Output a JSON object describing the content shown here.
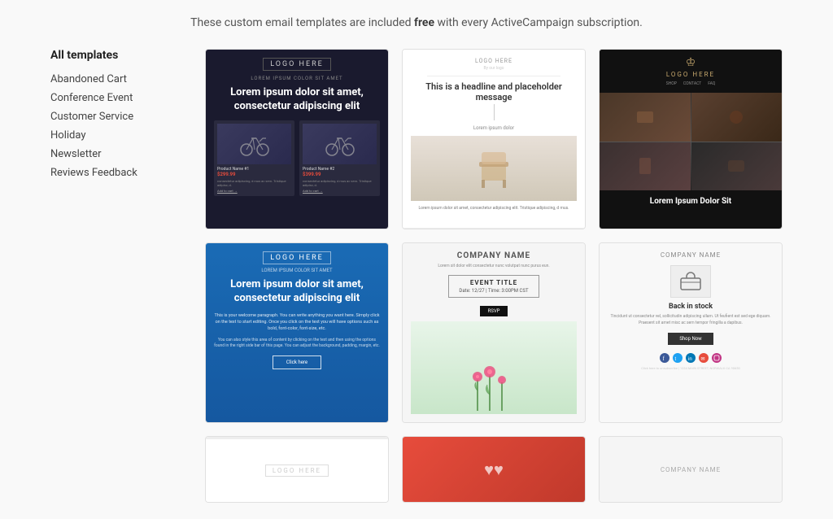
{
  "header": {
    "description_pre": "These custom email templates are included ",
    "description_highlight": "free",
    "description_post": " with every ActiveCampaign subscription."
  },
  "sidebar": {
    "title": "All templates",
    "items": [
      {
        "id": "abandoned-cart",
        "label": "Abandoned Cart"
      },
      {
        "id": "conference-event",
        "label": "Conference Event"
      },
      {
        "id": "customer-service",
        "label": "Customer Service"
      },
      {
        "id": "holiday",
        "label": "Holiday"
      },
      {
        "id": "newsletter",
        "label": "Newsletter"
      },
      {
        "id": "reviews-feedback",
        "label": "Reviews Feedback"
      }
    ]
  },
  "templates": {
    "grid_items": [
      {
        "id": "tpl-1",
        "type": "abandoned-cart-dark",
        "logo": "LOGO HERE",
        "sub": "LOREM IPSUM COLOR SIT AMET",
        "headline": "Lorem ipsum dolor sit amet, consectetur adipiscing elit",
        "product1_name": "Product Name #1",
        "product1_price": "$299.99",
        "product2_name": "Product Name #2",
        "product2_price": "$399.99",
        "add_to_cart": "Add to cart →"
      },
      {
        "id": "tpl-2",
        "type": "minimal-newsletter",
        "logo": "LOGO HERE",
        "tagline": "By our logo",
        "headline": "This is a headline and placeholder message",
        "lorem": "Lorem ipsum dolor",
        "body": "Lorem ipsum dolor sit amet, consectetur adipiscing elit. Tristique adipiscing, d mus."
      },
      {
        "id": "tpl-3",
        "type": "fashion-dark",
        "brand_name": "LOGO HERE",
        "nav_items": [
          "SHOP",
          "CONTACT",
          "FAQ"
        ],
        "caption": "Lorem Ipsum Dolor Sit"
      },
      {
        "id": "tpl-4",
        "type": "newsletter-blue",
        "logo": "LOGO HERE",
        "sub": "LOREM IPSUM COLOR SIT AMET",
        "headline": "Lorem ipsum dolor sit amet, consectetur adipiscing elit",
        "body": "This is your welcome paragraph. You can write anything you want here. Simply click on the text to start editing. Once you click on the text you will have options such as bold, font-color, font-size, etc.",
        "body2": "You can also style this area of content by clicking on the text and then using the options found in the right side bar of this page. You can adjust the background, padding, margin, etc.",
        "cta": "Click here"
      },
      {
        "id": "tpl-5",
        "type": "conference-event",
        "company": "COMPANY NAME",
        "tagline": "Lorem sit dolor elit consectetur nunc volutpat nunc purus eun.",
        "event_title": "EVENT TITLE",
        "event_date": "Date: 12/27  |  Time: 3:00PM CST",
        "rsvp": "RSVP",
        "flowers_desc": "flowers decoration"
      },
      {
        "id": "tpl-6",
        "type": "back-in-stock",
        "company": "COMPANY NAME",
        "back_text": "Back in stock",
        "lorem": "Tincidunt ut consectetur vel, sollicitudin adipiscing ullam. Ut feufient est sed ege diquam. Praesent sit amet misc ac sem tempor fringilla a dapibus.",
        "shop_btn": "Shop Now",
        "social_icons": [
          "facebook",
          "twitter",
          "linkedin",
          "email",
          "instagram"
        ],
        "footer": "Click here to unsubscribe | 1234 MAIN STREET, NORWALK CA 90650"
      }
    ]
  }
}
